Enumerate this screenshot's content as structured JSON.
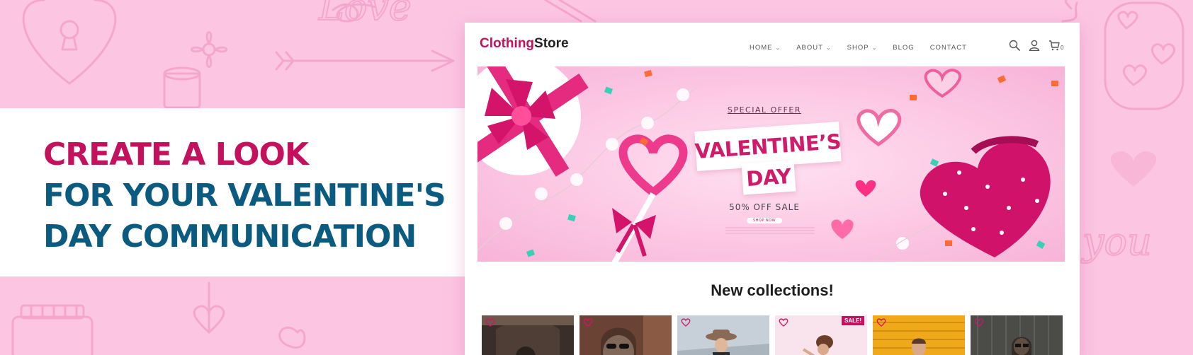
{
  "headline": {
    "line1": "Create a look",
    "line2": "for your Valentine's",
    "line3": "day communication"
  },
  "site": {
    "logo_part1": "Clothing",
    "logo_part2": "Store",
    "nav": [
      {
        "label": "HOME",
        "has_dropdown": true
      },
      {
        "label": "ABOUT",
        "has_dropdown": true
      },
      {
        "label": "SHOP",
        "has_dropdown": true
      },
      {
        "label": "BLOG",
        "has_dropdown": false
      },
      {
        "label": "CONTACT",
        "has_dropdown": false
      }
    ],
    "icons": [
      "search-icon",
      "user-icon",
      "cart-icon"
    ],
    "cart_count": "0"
  },
  "hero": {
    "special_offer": "SPECIAL OFFER",
    "title_line1": "VALENTINE’S",
    "title_line2": "DAY",
    "sale_text": "50% OFF SALE",
    "cta": "SHOP NOW"
  },
  "collections": {
    "title": "New collections!",
    "products": [
      {
        "name": "product-1",
        "bg": "#3a2e2a",
        "sale": false
      },
      {
        "name": "product-2",
        "bg": "#6b4334",
        "sale": false
      },
      {
        "name": "product-3",
        "bg": "#c7d0d8",
        "sale": false
      },
      {
        "name": "product-4",
        "bg": "#f9e4ee",
        "sale": true,
        "sale_label": "SALE!"
      },
      {
        "name": "product-5",
        "bg": "#f0a91b",
        "sale": false
      },
      {
        "name": "product-6",
        "bg": "#4b4b48",
        "sale": false
      }
    ]
  },
  "colors": {
    "background": "#fcc6e3",
    "brand_pink": "#c3115e",
    "headline_blue": "#0b5b80",
    "doodle_stroke": "#f5a6cd"
  }
}
